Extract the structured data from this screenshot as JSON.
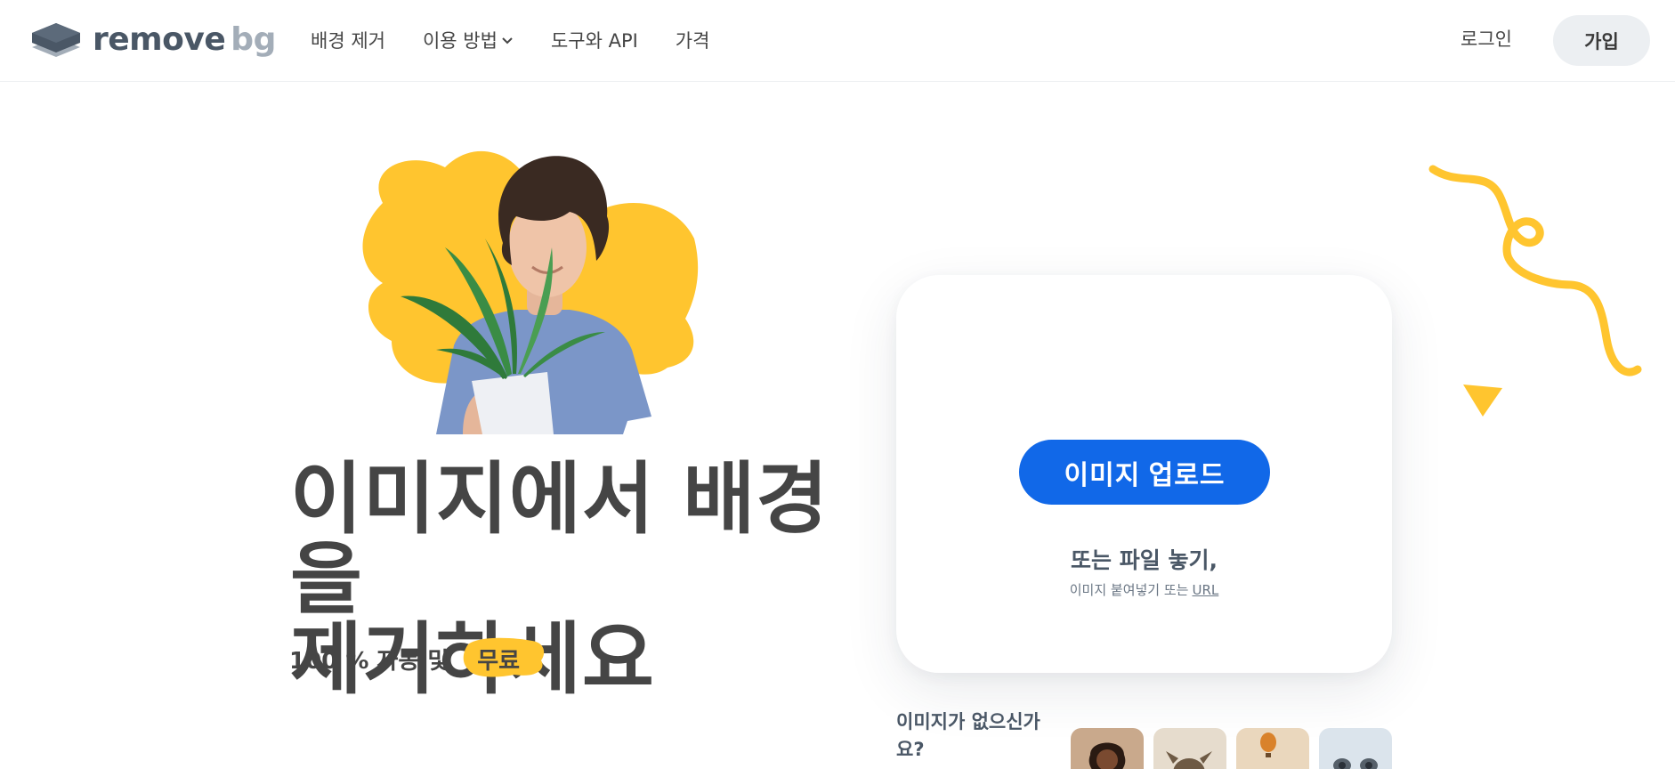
{
  "header": {
    "logo": {
      "word1": "remove",
      "word2": "bg"
    },
    "nav": [
      {
        "label": "배경 제거"
      },
      {
        "label": "이용 방법",
        "has_dropdown": true
      },
      {
        "label": "도구와 API"
      },
      {
        "label": "가격"
      }
    ],
    "login_label": "로그인",
    "signup_label": "가입"
  },
  "hero": {
    "headline_line1": "이미지에서 배경을",
    "headline_line2": "제거하세요",
    "sub_prefix": "100 % 자동 및",
    "sub_highlight": "무료"
  },
  "upload_card": {
    "button_label": "이미지 업로드",
    "drop_title": "또는 파일 놓기,",
    "drop_sub": "이미지 붙여넣기 또는",
    "url_link": "URL"
  },
  "samples": {
    "prompt": "이미지가 없으신가요?",
    "thumbnails": [
      "sample-woman",
      "sample-animal",
      "sample-balloon",
      "sample-car"
    ]
  },
  "colors": {
    "accent_blue": "#1168e8",
    "accent_yellow": "#ffc52f",
    "text_dark": "#454545",
    "logo_slate": "#4a5766"
  }
}
